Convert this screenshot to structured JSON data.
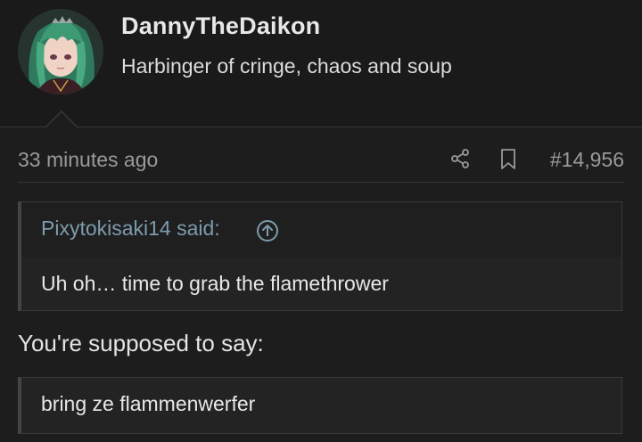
{
  "user": {
    "name": "DannyTheDaikon",
    "title": "Harbinger of cringe, chaos and soup",
    "avatar_icon": "anime-avatar"
  },
  "post": {
    "timestamp": "33 minutes ago",
    "number": "#14,956",
    "share_icon": "share-icon",
    "bookmark_icon": "bookmark-icon"
  },
  "quote": {
    "author_label": "Pixytokisaki14 said:",
    "text": "Uh oh… time to grab the flamethrower",
    "jump_icon": "arrow-up-circle-icon"
  },
  "message": {
    "text": "You're supposed to say:",
    "block_text": "bring ze flammenwerfer"
  },
  "colors": {
    "background": "#1d1d1d",
    "header_background": "#1a1a1a",
    "quote_author": "#7d9bad",
    "muted_text": "#9a9a9a",
    "border": "#3a3a3a"
  }
}
